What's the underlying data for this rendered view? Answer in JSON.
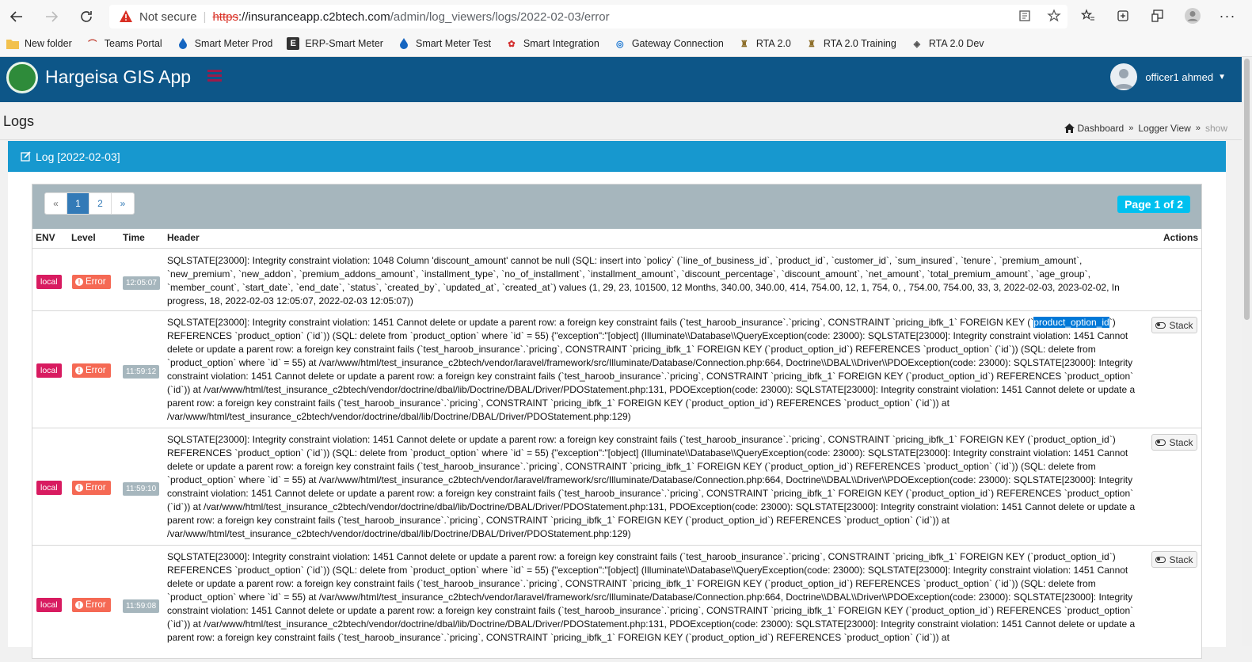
{
  "browser": {
    "security_label": "Not secure",
    "url_scheme": "https",
    "url_host": "://insuranceapp.c2btech.com",
    "url_path": "/admin/log_viewers/logs/2022-02-03/error",
    "bookmarks": [
      "New folder",
      "Teams Portal",
      "Smart Meter Prod",
      "ERP-Smart Meter",
      "Smart Meter Test",
      "Smart Integration",
      "Gateway Connection",
      "RTA 2.0",
      "RTA 2.0 Training",
      "RTA 2.0 Dev"
    ]
  },
  "app": {
    "brand": "Hargeisa GIS App",
    "user_name": "officer1 ahmed"
  },
  "page": {
    "title": "Logs",
    "breadcrumb": [
      "Dashboard",
      "Logger View",
      "show"
    ]
  },
  "box": {
    "title": "Log [2022-02-03]"
  },
  "pager": {
    "prev": "«",
    "pages": [
      "1",
      "2"
    ],
    "next": "»",
    "badge": "Page 1 of 2"
  },
  "table": {
    "headers": [
      "ENV",
      "Level",
      "Time",
      "Header",
      "Actions"
    ],
    "rows": [
      {
        "env": "local",
        "level": "Error",
        "time": "12:05:07",
        "message": "SQLSTATE[23000]: Integrity constraint violation: 1048 Column 'discount_amount' cannot be null (SQL: insert into `policy` (`line_of_business_id`, `product_id`, `customer_id`, `sum_insured`, `tenure`, `premium_amount`, `new_premium`, `new_addon`, `premium_addons_amount`, `installment_type`, `no_of_installment`, `installment_amount`, `discount_percentage`, `discount_amount`, `net_amount`, `total_premium_amount`, `age_group`, `member_count`, `start_date`, `end_date`, `status`, `created_by`, `updated_at`, `created_at`) values (1, 29, 23, 101500, 12 Months, 340.00, 340.00, 414, 754.00, 12, 1, 754, 0, , 754.00, 754.00, 33, 3, 2022-02-03, 2023-02-02, In progress, 18, 2022-02-03 12:05:07, 2022-02-03 12:05:07))",
        "action": ""
      },
      {
        "env": "local",
        "level": "Error",
        "time": "11:59:12",
        "message_pre": "SQLSTATE[23000]: Integrity constraint violation: 1451 Cannot delete or update a parent row: a foreign key constraint fails (`test_haroob_insurance`.`pricing`, CONSTRAINT `pricing_ibfk_1` FOREIGN KEY (`",
        "message_hl": "product_option_id",
        "message_post": "`) REFERENCES `product_option` (`id`)) (SQL: delete from `product_option` where `id` = 55) {\"exception\":\"[object] (Illuminate\\\\Database\\\\QueryException(code: 23000): SQLSTATE[23000]: Integrity constraint violation: 1451 Cannot delete or update a parent row: a foreign key constraint fails (`test_haroob_insurance`.`pricing`, CONSTRAINT `pricing_ibfk_1` FOREIGN KEY (`product_option_id`) REFERENCES `product_option` (`id`)) (SQL: delete from `product_option` where `id` = 55) at /var/www/html/test_insurance_c2btech/vendor/laravel/framework/src/Illuminate/Database/Connection.php:664, Doctrine\\\\DBAL\\\\Driver\\\\PDOException(code: 23000): SQLSTATE[23000]: Integrity constraint violation: 1451 Cannot delete or update a parent row: a foreign key constraint fails (`test_haroob_insurance`.`pricing`, CONSTRAINT `pricing_ibfk_1` FOREIGN KEY (`product_option_id`) REFERENCES `product_option` (`id`)) at /var/www/html/test_insurance_c2btech/vendor/doctrine/dbal/lib/Doctrine/DBAL/Driver/PDOStatement.php:131, PDOException(code: 23000): SQLSTATE[23000]: Integrity constraint violation: 1451 Cannot delete or update a parent row: a foreign key constraint fails (`test_haroob_insurance`.`pricing`, CONSTRAINT `pricing_ibfk_1` FOREIGN KEY (`product_option_id`) REFERENCES `product_option` (`id`)) at /var/www/html/test_insurance_c2btech/vendor/doctrine/dbal/lib/Doctrine/DBAL/Driver/PDOStatement.php:129)",
        "action": "Stack"
      },
      {
        "env": "local",
        "level": "Error",
        "time": "11:59:10",
        "message": "SQLSTATE[23000]: Integrity constraint violation: 1451 Cannot delete or update a parent row: a foreign key constraint fails (`test_haroob_insurance`.`pricing`, CONSTRAINT `pricing_ibfk_1` FOREIGN KEY (`product_option_id`) REFERENCES `product_option` (`id`)) (SQL: delete from `product_option` where `id` = 55) {\"exception\":\"[object] (Illuminate\\\\Database\\\\QueryException(code: 23000): SQLSTATE[23000]: Integrity constraint violation: 1451 Cannot delete or update a parent row: a foreign key constraint fails (`test_haroob_insurance`.`pricing`, CONSTRAINT `pricing_ibfk_1` FOREIGN KEY (`product_option_id`) REFERENCES `product_option` (`id`)) (SQL: delete from `product_option` where `id` = 55) at /var/www/html/test_insurance_c2btech/vendor/laravel/framework/src/Illuminate/Database/Connection.php:664, Doctrine\\\\DBAL\\\\Driver\\\\PDOException(code: 23000): SQLSTATE[23000]: Integrity constraint violation: 1451 Cannot delete or update a parent row: a foreign key constraint fails (`test_haroob_insurance`.`pricing`, CONSTRAINT `pricing_ibfk_1` FOREIGN KEY (`product_option_id`) REFERENCES `product_option` (`id`)) at /var/www/html/test_insurance_c2btech/vendor/doctrine/dbal/lib/Doctrine/DBAL/Driver/PDOStatement.php:131, PDOException(code: 23000): SQLSTATE[23000]: Integrity constraint violation: 1451 Cannot delete or update a parent row: a foreign key constraint fails (`test_haroob_insurance`.`pricing`, CONSTRAINT `pricing_ibfk_1` FOREIGN KEY (`product_option_id`) REFERENCES `product_option` (`id`)) at /var/www/html/test_insurance_c2btech/vendor/doctrine/dbal/lib/Doctrine/DBAL/Driver/PDOStatement.php:129)",
        "action": "Stack"
      },
      {
        "env": "local",
        "level": "Error",
        "time": "11:59:08",
        "message": "SQLSTATE[23000]: Integrity constraint violation: 1451 Cannot delete or update a parent row: a foreign key constraint fails (`test_haroob_insurance`.`pricing`, CONSTRAINT `pricing_ibfk_1` FOREIGN KEY (`product_option_id`) REFERENCES `product_option` (`id`)) (SQL: delete from `product_option` where `id` = 55) {\"exception\":\"[object] (Illuminate\\\\Database\\\\QueryException(code: 23000): SQLSTATE[23000]: Integrity constraint violation: 1451 Cannot delete or update a parent row: a foreign key constraint fails (`test_haroob_insurance`.`pricing`, CONSTRAINT `pricing_ibfk_1` FOREIGN KEY (`product_option_id`) REFERENCES `product_option` (`id`)) (SQL: delete from `product_option` where `id` = 55) at /var/www/html/test_insurance_c2btech/vendor/laravel/framework/src/Illuminate/Database/Connection.php:664, Doctrine\\\\DBAL\\\\Driver\\\\PDOException(code: 23000): SQLSTATE[23000]: Integrity constraint violation: 1451 Cannot delete or update a parent row: a foreign key constraint fails (`test_haroob_insurance`.`pricing`, CONSTRAINT `pricing_ibfk_1` FOREIGN KEY (`product_option_id`) REFERENCES `product_option` (`id`)) at /var/www/html/test_insurance_c2btech/vendor/doctrine/dbal/lib/Doctrine/DBAL/Driver/PDOStatement.php:131, PDOException(code: 23000): SQLSTATE[23000]: Integrity constraint violation: 1451 Cannot delete or update a parent row: a foreign key constraint fails (`test_haroob_insurance`.`pricing`, CONSTRAINT `pricing_ibfk_1` FOREIGN KEY (`product_option_id`) REFERENCES `product_option` (`id`)) at",
        "action": "Stack"
      }
    ]
  },
  "colors": {
    "header_bg": "#0d5688",
    "box_header": "#1798cf",
    "local_label": "#d81b60",
    "error_label": "#f56954",
    "time_label": "#a6b6bd",
    "page_badge": "#00c0ef"
  }
}
